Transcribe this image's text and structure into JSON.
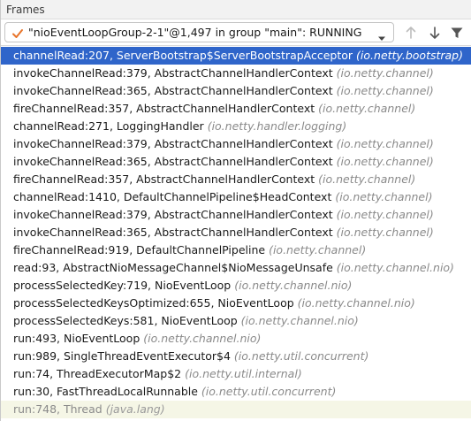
{
  "panel": {
    "title": "Frames"
  },
  "thread_selector": {
    "value": "\"nioEventLoopGroup-2-1\"@1,497 in group \"main\": RUNNING",
    "status_icon": "check-icon"
  },
  "toolbar": {
    "buttons": [
      "arrow-up-icon",
      "arrow-down-icon",
      "filter-icon"
    ]
  },
  "frames": [
    {
      "method": "channelRead:207, ServerBootstrap$ServerBootstrapAcceptor",
      "package": "(io.netty.bootstrap)",
      "selected": true
    },
    {
      "method": "invokeChannelRead:379, AbstractChannelHandlerContext",
      "package": "(io.netty.channel)"
    },
    {
      "method": "invokeChannelRead:365, AbstractChannelHandlerContext",
      "package": "(io.netty.channel)"
    },
    {
      "method": "fireChannelRead:357, AbstractChannelHandlerContext",
      "package": "(io.netty.channel)"
    },
    {
      "method": "channelRead:271, LoggingHandler",
      "package": "(io.netty.handler.logging)"
    },
    {
      "method": "invokeChannelRead:379, AbstractChannelHandlerContext",
      "package": "(io.netty.channel)"
    },
    {
      "method": "invokeChannelRead:365, AbstractChannelHandlerContext",
      "package": "(io.netty.channel)"
    },
    {
      "method": "fireChannelRead:357, AbstractChannelHandlerContext",
      "package": "(io.netty.channel)"
    },
    {
      "method": "channelRead:1410, DefaultChannelPipeline$HeadContext",
      "package": "(io.netty.channel)"
    },
    {
      "method": "invokeChannelRead:379, AbstractChannelHandlerContext",
      "package": "(io.netty.channel)"
    },
    {
      "method": "invokeChannelRead:365, AbstractChannelHandlerContext",
      "package": "(io.netty.channel)"
    },
    {
      "method": "fireChannelRead:919, DefaultChannelPipeline",
      "package": "(io.netty.channel)"
    },
    {
      "method": "read:93, AbstractNioMessageChannel$NioMessageUnsafe",
      "package": "(io.netty.channel.nio)"
    },
    {
      "method": "processSelectedKey:719, NioEventLoop",
      "package": "(io.netty.channel.nio)"
    },
    {
      "method": "processSelectedKeysOptimized:655, NioEventLoop",
      "package": "(io.netty.channel.nio)"
    },
    {
      "method": "processSelectedKeys:581, NioEventLoop",
      "package": "(io.netty.channel.nio)"
    },
    {
      "method": "run:493, NioEventLoop",
      "package": "(io.netty.channel.nio)"
    },
    {
      "method": "run:989, SingleThreadEventExecutor$4",
      "package": "(io.netty.util.concurrent)"
    },
    {
      "method": "run:74, ThreadExecutorMap$2",
      "package": "(io.netty.util.internal)"
    },
    {
      "method": "run:30, FastThreadLocalRunnable",
      "package": "(io.netty.util.concurrent)"
    },
    {
      "method": "run:748, Thread",
      "package": "(java.lang)",
      "library": true
    }
  ],
  "colors": {
    "selection": "#2f65ca",
    "package_text": "#8a8a8a",
    "check": "#e8742a"
  }
}
